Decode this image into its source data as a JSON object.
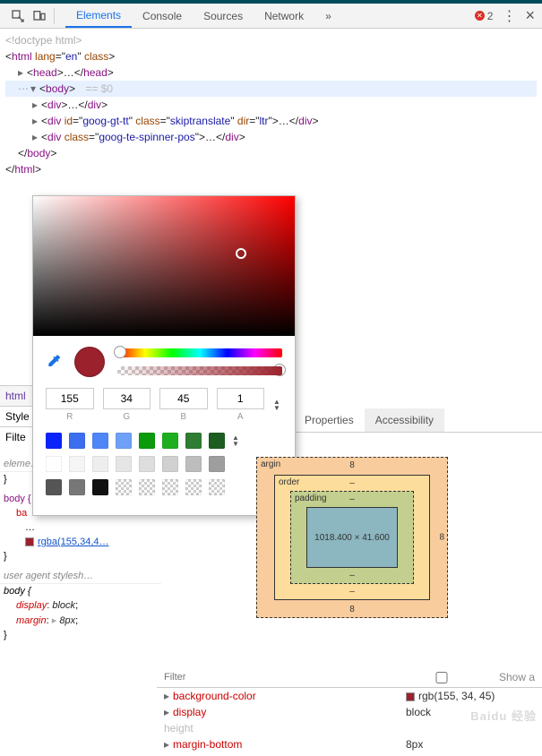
{
  "toolbar": {
    "tabs": [
      "Elements",
      "Console",
      "Sources",
      "Network"
    ],
    "more_icon": "»",
    "error_count": "2",
    "menu_icon": "⋮",
    "close_icon": "×"
  },
  "dom": {
    "doctype": "<!doctype html>",
    "html_open": {
      "tag": "html",
      "attrs": [
        {
          "n": "lang",
          "v": "en"
        },
        {
          "n": "class",
          "v": ""
        }
      ]
    },
    "head": {
      "open": "head",
      "dots": "…",
      "close": "head"
    },
    "body": {
      "tag": "body",
      "eq": " == $0"
    },
    "div1": {
      "tag": "div",
      "dots": "…"
    },
    "div2": {
      "tag": "div",
      "attrs": [
        {
          "n": "id",
          "v": "goog-gt-tt"
        },
        {
          "n": "class",
          "v": "skiptranslate"
        },
        {
          "n": "dir",
          "v": "ltr"
        }
      ],
      "dots": "…"
    },
    "div3": {
      "tag": "div",
      "attrs": [
        {
          "n": "class",
          "v": "goog-te-spinner-pos"
        }
      ],
      "dots": "…"
    },
    "body_close": "body",
    "html_close": "html"
  },
  "crumbs": {
    "html": "html"
  },
  "style_tabs": {
    "styles": "Style",
    "filter": "Filte"
  },
  "right_tabs": {
    "props": "Properties",
    "acc": "Accessibility"
  },
  "styles_pane": {
    "r1_head": "eleme…",
    "r1_body": "}",
    "r2_sel": "body {",
    "r2_prop": "ba",
    "r2_prop2": "…",
    "r2_val": "rgba(155,34,4…",
    "r2_close": "}",
    "r3_head": "user agent stylesh…",
    "r3_sel": "body {",
    "r3_p1": {
      "n": "display",
      "v": "block"
    },
    "r3_p2": {
      "n": "margin",
      "arrow": "▸",
      "v": "8px"
    },
    "r3_close": "}"
  },
  "picker": {
    "rgba": {
      "r": "155",
      "g": "34",
      "b": "45",
      "a": "1"
    },
    "labels": {
      "r": "R",
      "g": "G",
      "b": "B",
      "a": "A"
    },
    "palette": [
      [
        "#0b24fb",
        "#3b6fef",
        "#4f86f7",
        "#6fa0f7",
        "#0b9b0b",
        "#1fae1f",
        "#2e7d32",
        "#1b5e20"
      ],
      [
        "#ffffff",
        "#f5f5f5",
        "#eeeeee",
        "#e5e5e5",
        "#dddddd",
        "#d0d0d0",
        "#bdbdbd",
        "#9e9e9e"
      ],
      [
        "#555555",
        "#777777",
        "#111111",
        "t1",
        "t2",
        "t3",
        "t4",
        "t5"
      ]
    ]
  },
  "box_model": {
    "margin": {
      "label": "argin",
      "t": "8",
      "r": "8",
      "b": "8",
      "l": "-"
    },
    "border": {
      "label": "order",
      "t": "–",
      "r": "–",
      "b": "–",
      "l": "-"
    },
    "padding": {
      "label": "padding",
      "t": "–",
      "r": "-",
      "b": "–",
      "l": "-"
    },
    "content": "1018.400 × 41.600"
  },
  "computed": {
    "filter_ph": "Filter",
    "show_all": "Show a",
    "rows": [
      {
        "n": "background-color",
        "v": "rgb(155, 34, 45)",
        "swatch": true
      },
      {
        "n": "display",
        "v": "block"
      },
      {
        "n": "height",
        "v": "",
        "inherited": true
      },
      {
        "n": "margin-bottom",
        "v": "8px"
      }
    ]
  },
  "watermark": "Baidu 经验"
}
